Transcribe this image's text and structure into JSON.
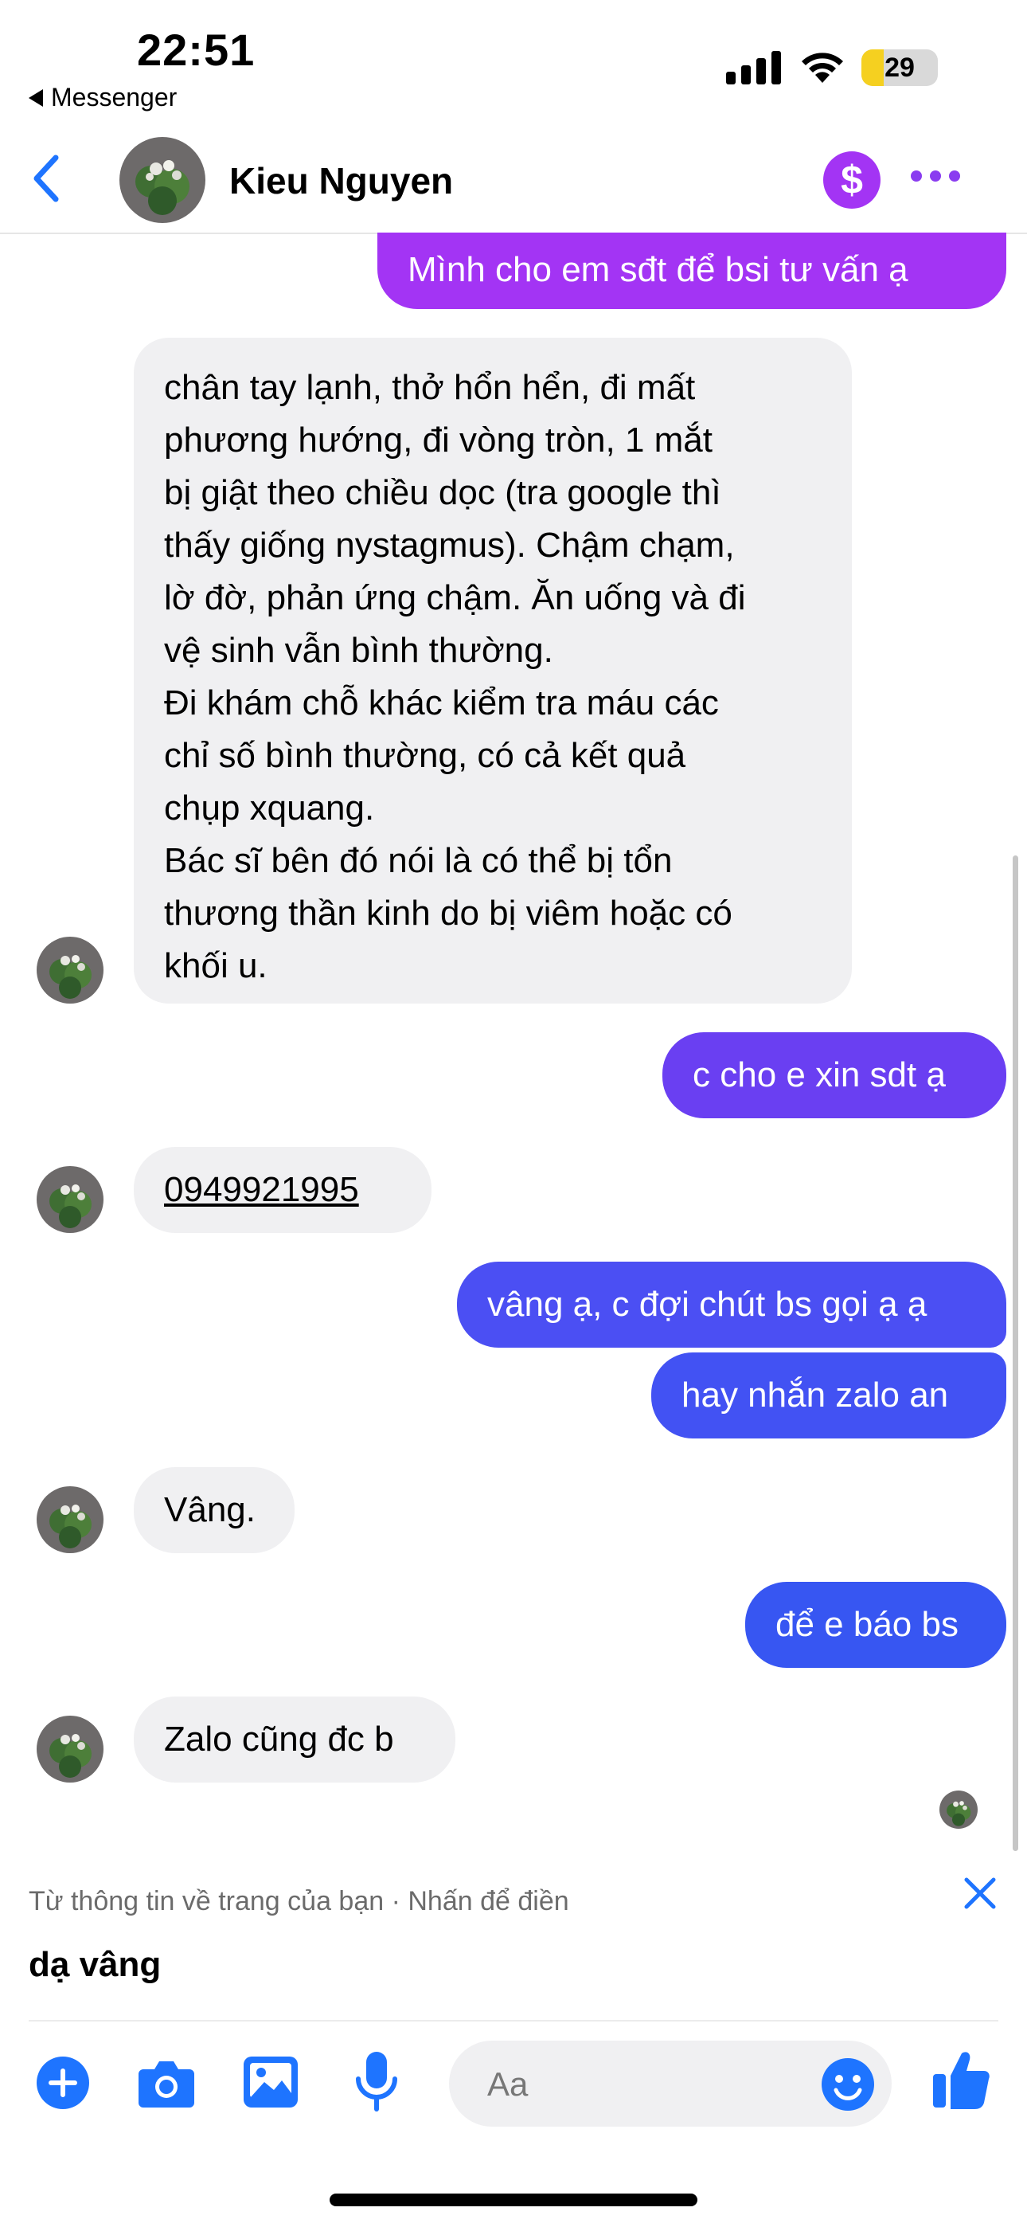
{
  "status_bar": {
    "time": "22:51",
    "back_app": "Messenger",
    "battery": "29",
    "battery_level": 0.29,
    "battery_color": "#f5d020"
  },
  "header": {
    "contact_name": "Kieu Nguyen",
    "payment_icon": "dollar-icon",
    "more_icon": "more-icon",
    "accent": "#8a3cf0"
  },
  "messages": [
    {
      "direction": "out",
      "text": "Mình cho em sđt để bsi tư vấn ạ",
      "color": "#a334f4"
    },
    {
      "direction": "in",
      "lines": [
        "chân tay lạnh, thở hổn hển, đi mất",
        "phương hướng, đi vòng tròn, 1 mắt",
        "bị giật theo chiều dọc (tra google thì",
        "thấy giống nystagmus). Chậm chạm,",
        "lờ đờ, phản ứng chậm. Ăn uống và đi",
        "vệ sinh vẫn bình thường.",
        "Đi khám chỗ khác kiểm tra máu các",
        "chỉ số bình thường, có cả kết quả",
        "chụp xquang.",
        "Bác sĩ bên đó nói là có thể bị tổn",
        "thương thần kinh do bị viêm hoặc có",
        "khối u."
      ]
    },
    {
      "direction": "out",
      "text": "c cho e xin sdt ạ",
      "color": "#6a3ff2"
    },
    {
      "direction": "in",
      "text": "0949921995"
    },
    {
      "direction": "out",
      "text": "vâng ạ, c đợi chút bs gọi ạ ạ",
      "color": "#4b4ff3"
    },
    {
      "direction": "out",
      "text": "hay nhắn zalo an",
      "color": "#4252f3"
    },
    {
      "direction": "in",
      "text": "Vâng."
    },
    {
      "direction": "out",
      "text": "để e báo bs",
      "color": "#3756f2"
    },
    {
      "direction": "in",
      "text": "Zalo cũng đc b"
    }
  ],
  "suggestion": {
    "hint": "Từ thông tin về trang của bạn · Nhấn để điền",
    "text": "dạ vâng"
  },
  "composer": {
    "placeholder": "Aa",
    "icon_color": "#1e74ff",
    "icons": [
      "plus-icon",
      "camera-icon",
      "photo-icon",
      "microphone-icon",
      "emoji-icon",
      "thumbs-up-icon"
    ]
  }
}
